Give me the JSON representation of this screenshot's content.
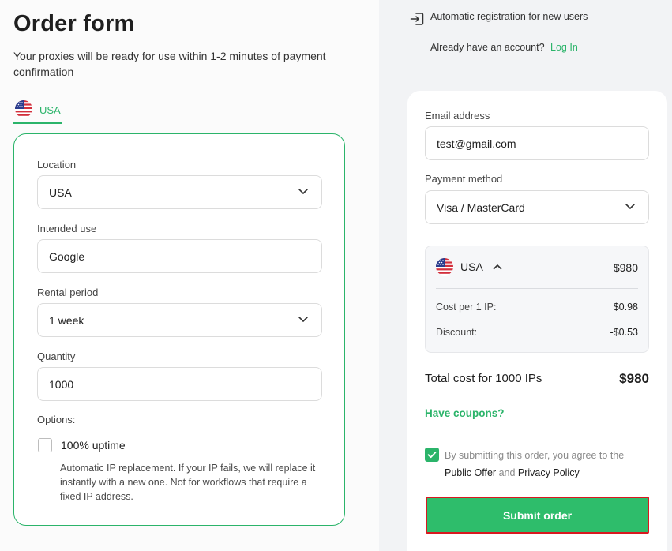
{
  "page": {
    "title": "Order form",
    "subtitle": "Your proxies will be ready for use within 1-2 minutes of payment confirmation"
  },
  "country_tab": {
    "label": "USA",
    "flag_icon": "us-flag-icon"
  },
  "form": {
    "location": {
      "label": "Location",
      "value": "USA"
    },
    "intended_use": {
      "label": "Intended use",
      "value": "Google"
    },
    "rental_period": {
      "label": "Rental period",
      "value": "1 week"
    },
    "quantity": {
      "label": "Quantity",
      "value": "1000"
    },
    "options": {
      "label": "Options:",
      "uptime_label": "100% uptime",
      "uptime_checked": false,
      "uptime_description": "Automatic IP replacement. If your IP fails, we will replace it instantly with a new one. Not for workflows that require a fixed IP address."
    }
  },
  "registration": {
    "icon": "sign-in-icon",
    "text": "Automatic registration for new users",
    "account_prompt": "Already have an account?",
    "login_link": "Log In"
  },
  "checkout": {
    "email": {
      "label": "Email address",
      "value": "test@gmail.com"
    },
    "payment": {
      "label": "Payment method",
      "value": "Visa / MasterCard"
    },
    "summary": {
      "country": "USA",
      "price": "$980",
      "cost_per_ip_label": "Cost per 1 IP:",
      "cost_per_ip_value": "$0.98",
      "discount_label": "Discount:",
      "discount_value": "-$0.53"
    },
    "total_label": "Total cost for 1000 IPs",
    "total_value": "$980",
    "coupons_link": "Have coupons?",
    "agreement": {
      "checked": true,
      "text_prefix": "By submitting this order, you agree to the",
      "public_offer": "Public Offer",
      "and": "and",
      "privacy_policy": "Privacy Policy"
    },
    "submit_label": "Submit order"
  },
  "colors": {
    "accent": "#2bb46a",
    "submit_bg": "#2ebd6b",
    "submit_border": "#d9181f",
    "right_panel_bg": "#f2f3f5"
  }
}
